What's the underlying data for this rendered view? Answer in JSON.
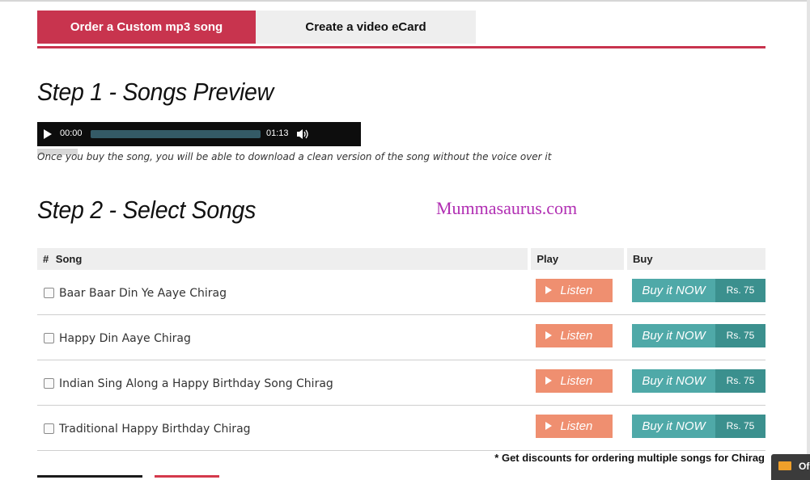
{
  "tabs": [
    {
      "label": "Order a Custom mp3 song",
      "active": true
    },
    {
      "label": "Create a video eCard",
      "active": false
    }
  ],
  "step1": {
    "heading": "Step 1 - Songs Preview",
    "player": {
      "current_time": "00:00",
      "duration": "01:13",
      "progress": 0
    },
    "note": "Once you buy the song, you will be able to download a clean version of the song without the voice over it"
  },
  "step2": {
    "heading": "Step 2 - Select Songs"
  },
  "watermark": "Mummasaurus.com",
  "table": {
    "headers": {
      "num": "#",
      "song": "Song",
      "play": "Play",
      "buy": "Buy"
    },
    "listen_label": "Listen",
    "buy_label": "Buy it NOW",
    "rows": [
      {
        "song": "Baar Baar Din Ye Aaye Chirag",
        "price": "Rs. 75",
        "checked": false
      },
      {
        "song": "Happy Din Aaye Chirag",
        "price": "Rs. 75",
        "checked": false
      },
      {
        "song": "Indian Sing Along a Happy Birthday Song Chirag",
        "price": "Rs. 75",
        "checked": false
      },
      {
        "song": "Traditional Happy Birthday Chirag",
        "price": "Rs. 75",
        "checked": false
      }
    ]
  },
  "discount_note": "* Get discounts for ordering multiple songs for Chirag",
  "chat_widget": {
    "label": "Of",
    "icon": "mail-icon"
  },
  "colors": {
    "accent": "#c8344e",
    "listen": "#ef8f70",
    "buy": "#4fa9a8",
    "buy_price": "#3b908e",
    "watermark": "#b12fb3"
  }
}
